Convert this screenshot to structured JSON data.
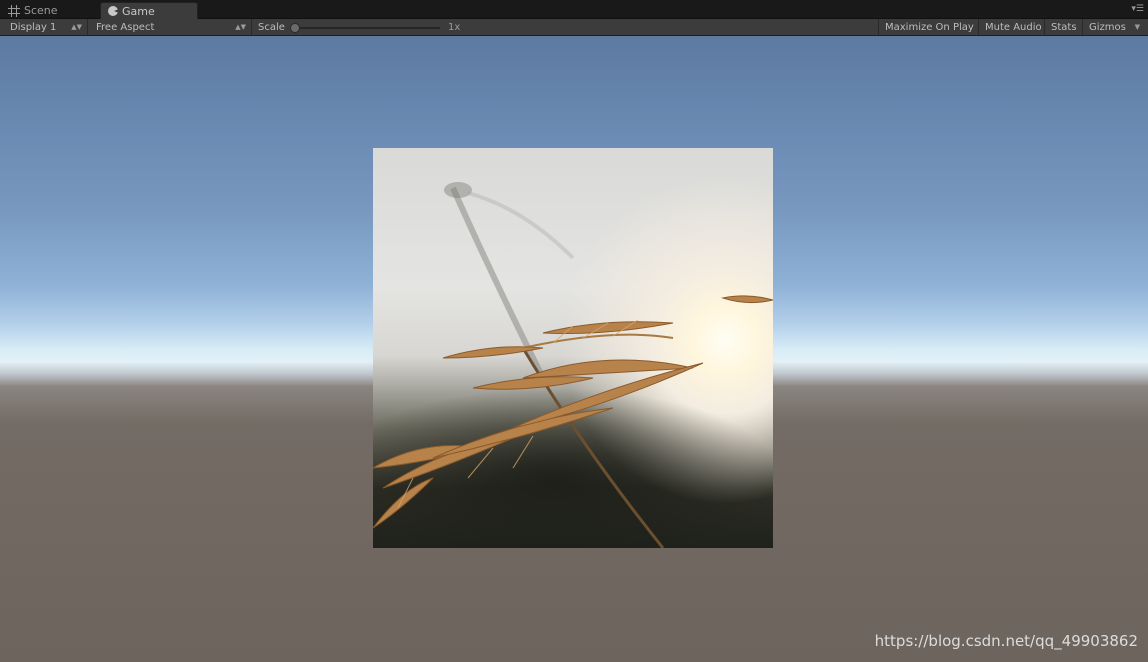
{
  "tabs": [
    {
      "label": "Scene",
      "icon": "hash-icon",
      "active": false
    },
    {
      "label": "Game",
      "icon": "pacman-icon",
      "active": true
    }
  ],
  "toolbar": {
    "display": "Display 1",
    "aspect": "Free Aspect",
    "scale_label": "Scale",
    "scale_value": "1x",
    "maximize_on_play": "Maximize On Play",
    "mute_audio": "Mute Audio",
    "stats": "Stats",
    "gizmos": "Gizmos"
  },
  "watermark": "https://blog.csdn.net/qq_49903862",
  "colors": {
    "tab_bar": "#191919",
    "toolbar": "#3c3c3c",
    "sky_top": "#5d7aa0",
    "horizon": "#e3f1f8",
    "ground": "#6d645d"
  }
}
